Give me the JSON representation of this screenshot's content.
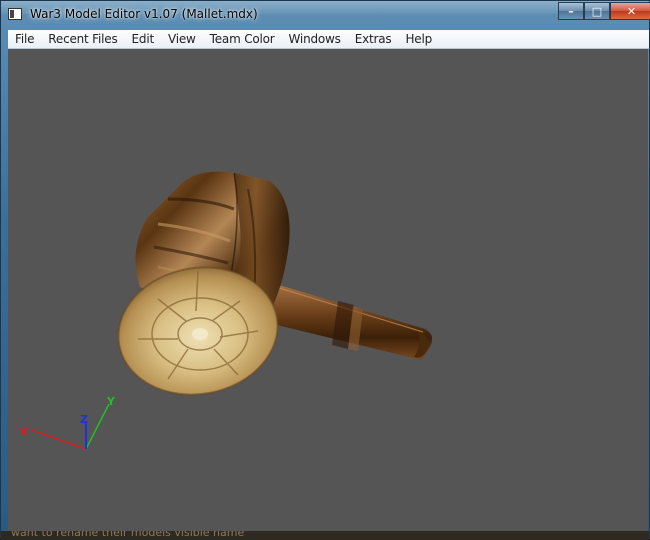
{
  "window": {
    "title": "War3 Model Editor v1.07 (Mallet.mdx)",
    "icon": "app-window-icon"
  },
  "caption_buttons": {
    "minimize": "–",
    "maximize": "□",
    "close": "✕"
  },
  "menu": {
    "items": [
      {
        "label": "File",
        "name": "menu-file"
      },
      {
        "label": "Recent Files",
        "name": "menu-recent-files"
      },
      {
        "label": "Edit",
        "name": "menu-edit"
      },
      {
        "label": "View",
        "name": "menu-view"
      },
      {
        "label": "Team Color",
        "name": "menu-team-color"
      },
      {
        "label": "Windows",
        "name": "menu-windows"
      },
      {
        "label": "Extras",
        "name": "menu-extras"
      },
      {
        "label": "Help",
        "name": "menu-help"
      }
    ]
  },
  "viewport": {
    "background": "#555555",
    "model": "mallet-3d-model",
    "axes": {
      "x_label": "X",
      "y_label": "Y",
      "z_label": "Z",
      "x_color": "#d22020",
      "y_color": "#20c020",
      "z_color": "#2030e0"
    }
  },
  "bottom_strip": {
    "text": "want to rename their models visible name"
  }
}
